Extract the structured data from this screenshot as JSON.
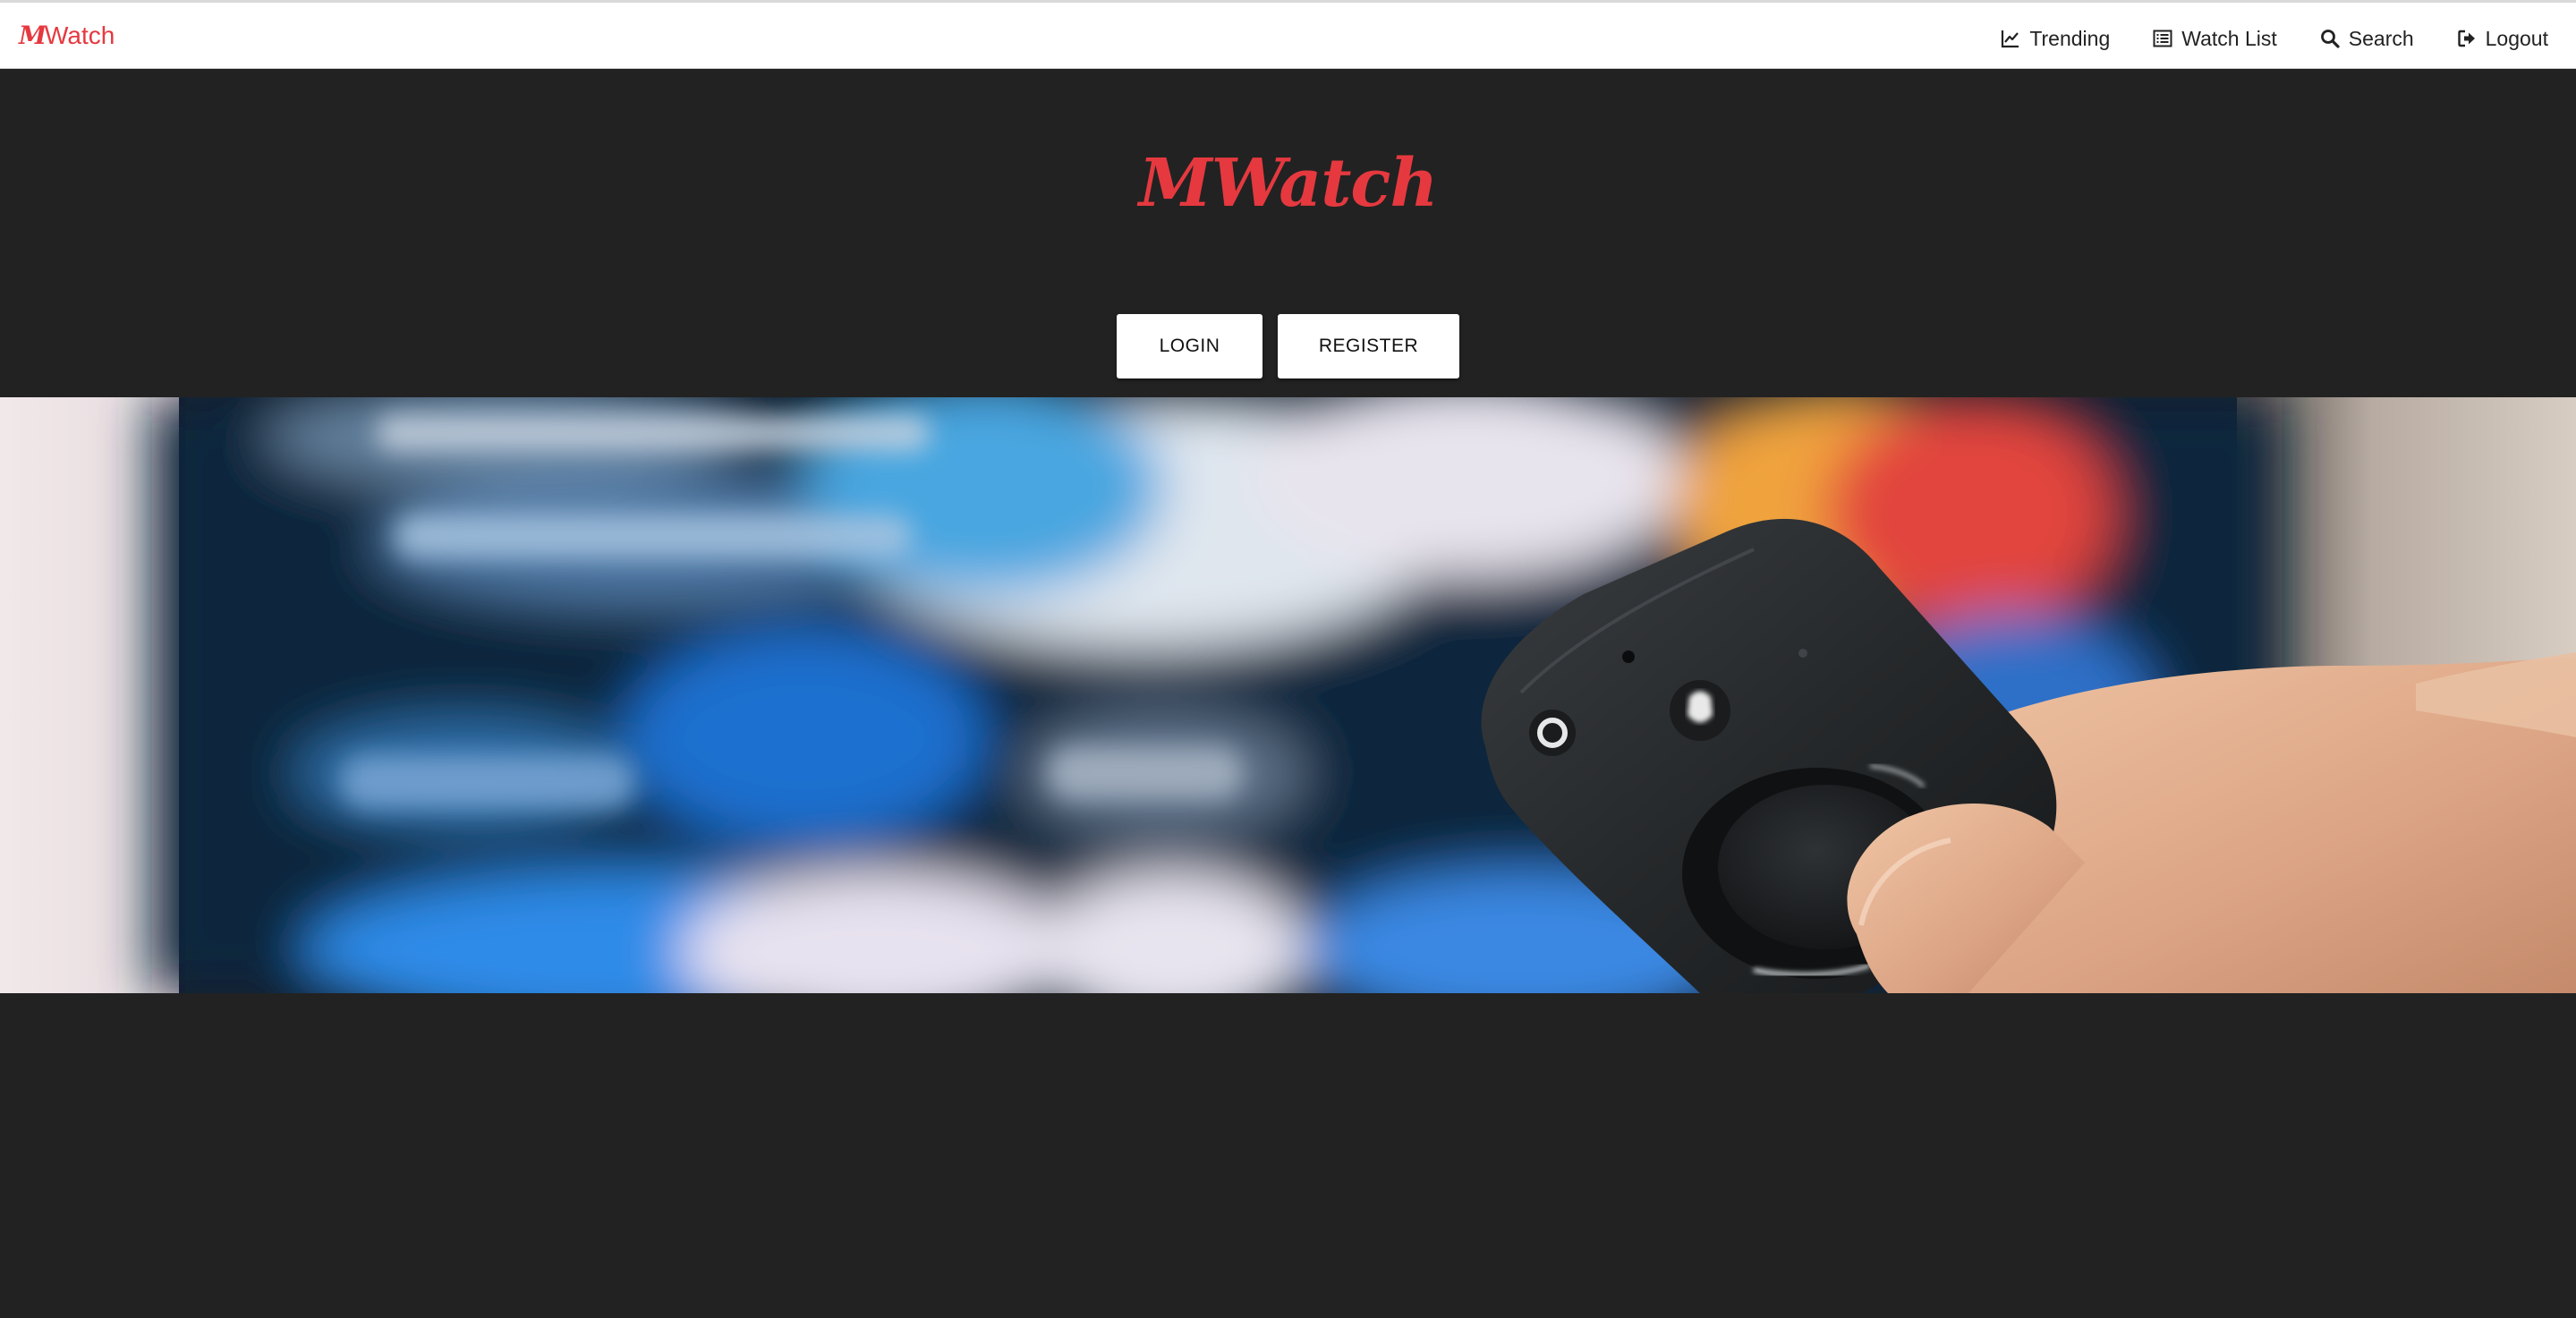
{
  "brand": {
    "prefix": "M",
    "suffix": "Watch",
    "color": "#e5393f"
  },
  "nav": {
    "items": [
      {
        "label": "Trending",
        "icon": "line-chart-icon"
      },
      {
        "label": "Watch List",
        "icon": "list-icon"
      },
      {
        "label": "Search",
        "icon": "search-icon"
      },
      {
        "label": "Logout",
        "icon": "logout-icon"
      }
    ]
  },
  "hero": {
    "title": "MWatch"
  },
  "auth": {
    "login_label": "LOGIN",
    "register_label": "REGISTER"
  },
  "banner": {
    "subject": "hand holding TV remote in front of blurred screen"
  },
  "colors": {
    "background": "#222222",
    "topbar": "#ffffff",
    "accent": "#e5393f"
  }
}
